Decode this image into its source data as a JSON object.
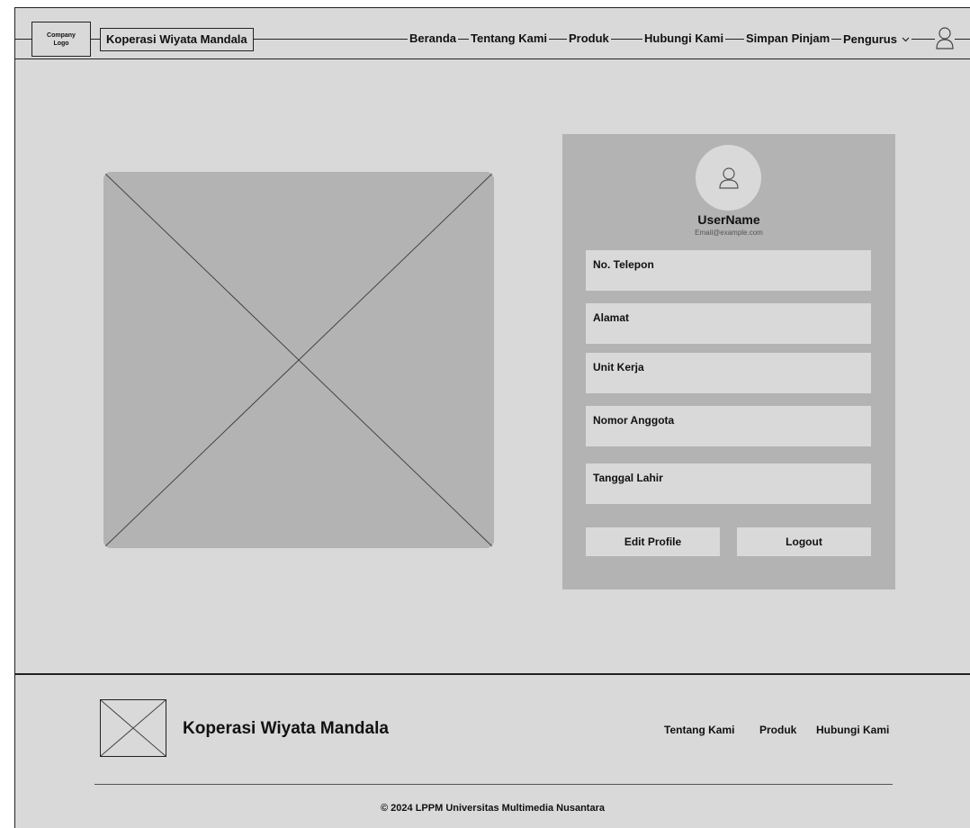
{
  "header": {
    "logo_line1": "Company",
    "logo_line2": "Logo",
    "brand": "Koperasi Wiyata Mandala",
    "nav": [
      "Beranda",
      "Tentang Kami",
      "Produk",
      "Hubungi Kami",
      "Simpan Pinjam",
      "Pengurus"
    ],
    "user_icon": "user-icon",
    "dropdown_icon": "chevron-down-icon"
  },
  "main": {
    "image_placeholder": "image-placeholder-icon"
  },
  "profile": {
    "username": "UserName",
    "email": "Email@example.com",
    "fields": [
      "No. Telepon",
      "Alamat",
      "Unit Kerja",
      "Nomor Anggota",
      "Tanggal Lahir"
    ],
    "edit_label": "Edit Profile",
    "logout_label": "Logout"
  },
  "footer": {
    "brand": "Koperasi Wiyata Mandala",
    "links": [
      "Tentang Kami",
      "Produk",
      "Hubungi Kami"
    ],
    "copyright": "© 2024 LPPM Universitas Multimedia Nusantara"
  },
  "colors": {
    "background": "#d9d9d9",
    "card": "#b3b3b3",
    "line": "#222222"
  }
}
